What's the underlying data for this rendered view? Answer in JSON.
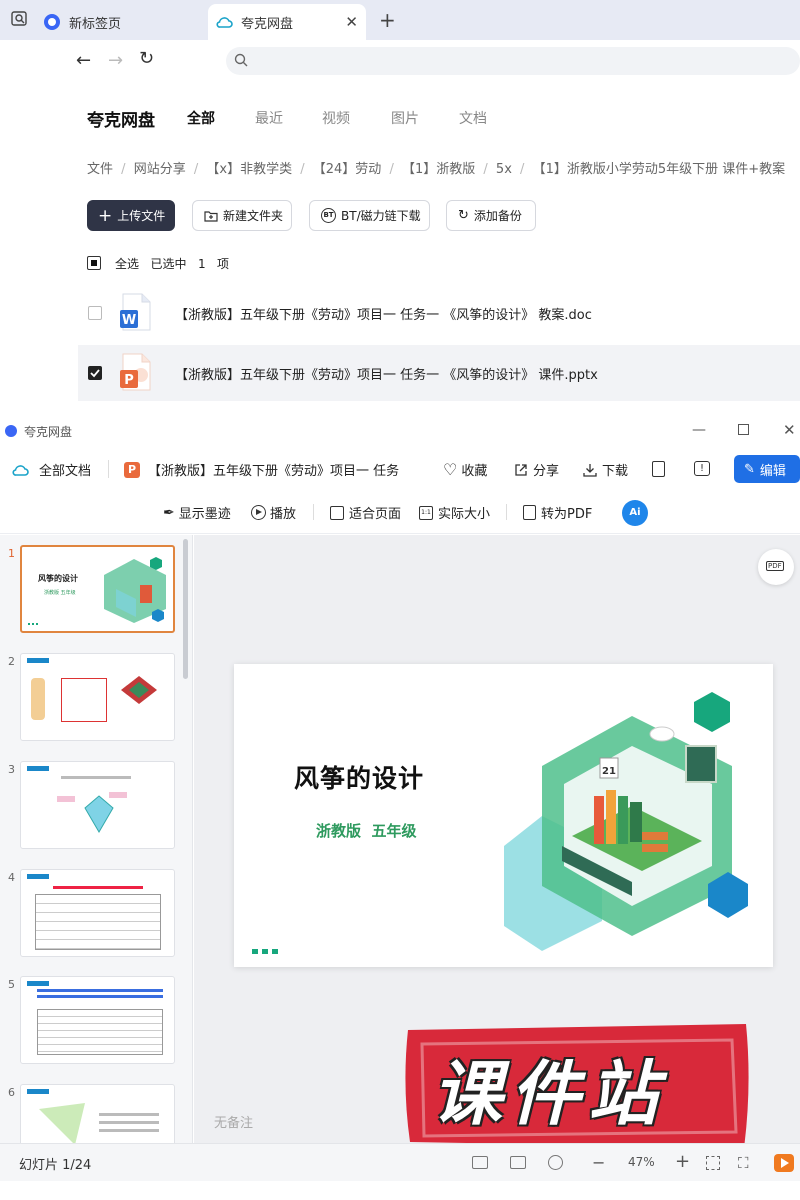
{
  "browser": {
    "tabs": [
      {
        "label": "新标签页"
      },
      {
        "label": "夸克网盘"
      }
    ],
    "address": ""
  },
  "cloud": {
    "brand": "夸克网盘",
    "nav": [
      "全部",
      "最近",
      "视频",
      "图片",
      "文档"
    ],
    "breadcrumb": [
      "文件",
      "网站分享",
      "【x】非教学类",
      "【24】劳动",
      "【1】浙教版",
      "5x",
      "【1】浙教版小学劳动5年级下册 课件+教案"
    ],
    "buttons": {
      "upload": "上传文件",
      "new_folder": "新建文件夹",
      "bt": "BT/磁力链下载",
      "backup": "添加备份"
    },
    "selection": {
      "select_all": "全选",
      "selected": "已选中",
      "count": "1",
      "unit": "项"
    },
    "files": [
      {
        "name": "【浙教版】五年级下册《劳动》项目一 任务一 《风筝的设计》 教案.doc",
        "type": "word",
        "checked": false
      },
      {
        "name": "【浙教版】五年级下册《劳动》项目一 任务一 《风筝的设计》 课件.pptx",
        "type": "ppt",
        "checked": true
      }
    ]
  },
  "viewer": {
    "title": "夸克网盘",
    "all_docs": "全部文档",
    "doc_title": "【浙教版】五年级下册《劳动》项目一 任务",
    "actions": {
      "collect": "收藏",
      "share": "分享",
      "download": "下载",
      "edit": "编辑"
    },
    "sub": {
      "ink": "显示墨迹",
      "play": "播放",
      "fit": "适合页面",
      "actual": "实际大小",
      "pdf": "转为PDF",
      "ai": "Ai",
      "pdf_badge": "PDF"
    },
    "thumbnails": [
      "1",
      "2",
      "3",
      "4",
      "5",
      "6"
    ],
    "slide": {
      "title": "风筝的设计",
      "subtitle": "浙教版  五年级",
      "calendar": "21"
    },
    "notes": "无备注",
    "status": {
      "slide_counter": "幻灯片 1/24",
      "zoom": "47%"
    },
    "watermark": "课件站",
    "colors": {
      "accent": "#1f6fe5",
      "brand_green": "#2e9a5e",
      "watermark_red": "#d8293a"
    }
  }
}
